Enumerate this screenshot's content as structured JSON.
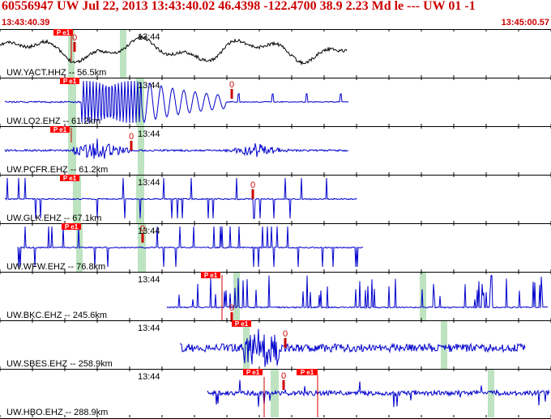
{
  "header": {
    "title": "60556947 UW Jul 22, 2013 13:43:40.02   46.4398 -122.4700 38.9 2.23 Md le --- UW 01  -1",
    "start_time": "13:43:40.39",
    "end_time": "13:45:00.57"
  },
  "colors": {
    "header_text": "#cc0000",
    "trace_first": "#000000",
    "trace": "#0000cc",
    "pick_box": "#ff0000",
    "pick_line": "#cc0000",
    "window": "#bde3c0",
    "frame": "#000000"
  },
  "channels": [
    {
      "label": "UW.YACT.HHZ -- 56.5km",
      "time_label": "13:44",
      "pick_label": "P e1",
      "zero_label": "0"
    },
    {
      "label": "UW.LO2.EHZ -- 61.2km",
      "time_label": "13:44",
      "pick_label": "P e1",
      "zero_label": "0"
    },
    {
      "label": "UW.PCFR.EHZ -- 61.2km",
      "time_label": "13:44",
      "pick_label": "P e1",
      "zero_label": "0"
    },
    {
      "label": "UW.GLK.EHZ -- 67.1km",
      "time_label": "13:44",
      "pick_label": "P e1",
      "zero_label": "0"
    },
    {
      "label": "UW.WFW.EHZ -- 76.8km",
      "time_label": "13:44",
      "pick_label": "P e1",
      "zero_label": "0"
    },
    {
      "label": "UW.BKC.EHZ -- 245.6km",
      "time_label": "13:44",
      "pick_label": "P e1",
      "zero_label": "0"
    },
    {
      "label": "UW.SBES.EHZ -- 258.9km",
      "time_label": "13:44",
      "pick_label": "P e1",
      "zero_label": "0"
    },
    {
      "label": "UW.HBO.EHZ -- 288.9km",
      "time_label": "13:44",
      "pick_label": "P e1",
      "zero_label": "0",
      "pick_label_2": "P e1"
    }
  ]
}
